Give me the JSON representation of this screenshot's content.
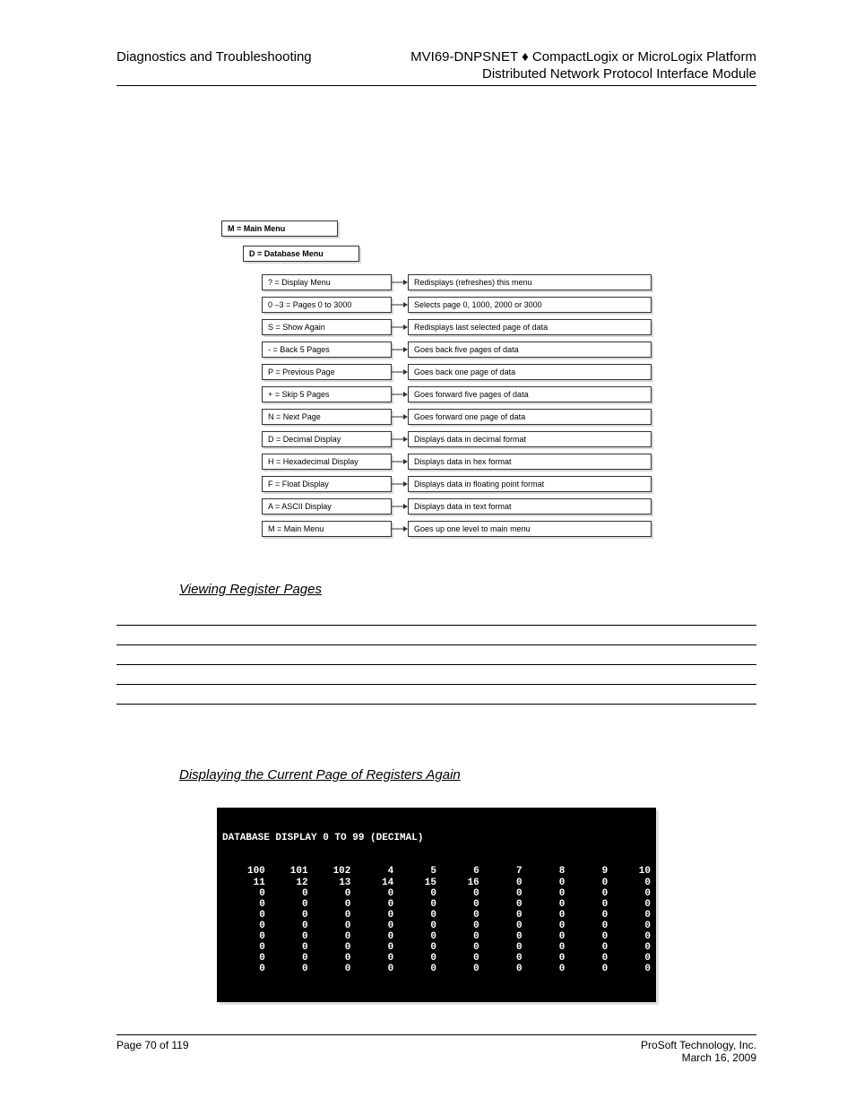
{
  "header": {
    "left": "Diagnostics and Troubleshooting",
    "right1": "MVI69-DNPSNET ♦ CompactLogix or MicroLogix Platform",
    "right2": "Distributed Network Protocol Interface Module"
  },
  "diagram": {
    "top1": "M = Main Menu",
    "top2": "D = Database Menu",
    "rows": [
      {
        "cmd": "? = Display Menu",
        "desc": "Redisplays (refreshes) this menu"
      },
      {
        "cmd": "0 –3 = Pages 0 to 3000",
        "desc": "Selects page 0, 1000, 2000 or 3000"
      },
      {
        "cmd": "S = Show Again",
        "desc": "Redisplays last selected page of data"
      },
      {
        "cmd": "- = Back 5 Pages",
        "desc": "Goes back five pages of data"
      },
      {
        "cmd": "P = Previous Page",
        "desc": "Goes back one page of data"
      },
      {
        "cmd": "+ = Skip 5 Pages",
        "desc": "Goes forward five pages of data"
      },
      {
        "cmd": "N = Next Page",
        "desc": "Goes forward one page of data"
      },
      {
        "cmd": "D = Decimal Display",
        "desc": "Displays data in decimal format"
      },
      {
        "cmd": "H = Hexadecimal Display",
        "desc": "Displays data in hex format"
      },
      {
        "cmd": "F = Float Display",
        "desc": "Displays data in floating point format"
      },
      {
        "cmd": "A = ASCII Display",
        "desc": "Displays data in text format"
      },
      {
        "cmd": "M = Main Menu",
        "desc": "Goes up one level to main menu"
      }
    ]
  },
  "section1": {
    "heading": "Viewing Register Pages"
  },
  "section2": {
    "heading": "Displaying the Current Page of Registers Again"
  },
  "terminal": {
    "title": "DATABASE DISPLAY 0 TO 99 (DECIMAL)",
    "rows": [
      [
        "100",
        "101",
        "102",
        "4",
        "5",
        "6",
        "7",
        "8",
        "9",
        "10"
      ],
      [
        "11",
        "12",
        "13",
        "14",
        "15",
        "16",
        "0",
        "0",
        "0",
        "0"
      ],
      [
        "0",
        "0",
        "0",
        "0",
        "0",
        "0",
        "0",
        "0",
        "0",
        "0"
      ],
      [
        "0",
        "0",
        "0",
        "0",
        "0",
        "0",
        "0",
        "0",
        "0",
        "0"
      ],
      [
        "0",
        "0",
        "0",
        "0",
        "0",
        "0",
        "0",
        "0",
        "0",
        "0"
      ],
      [
        "0",
        "0",
        "0",
        "0",
        "0",
        "0",
        "0",
        "0",
        "0",
        "0"
      ],
      [
        "0",
        "0",
        "0",
        "0",
        "0",
        "0",
        "0",
        "0",
        "0",
        "0"
      ],
      [
        "0",
        "0",
        "0",
        "0",
        "0",
        "0",
        "0",
        "0",
        "0",
        "0"
      ],
      [
        "0",
        "0",
        "0",
        "0",
        "0",
        "0",
        "0",
        "0",
        "0",
        "0"
      ],
      [
        "0",
        "0",
        "0",
        "0",
        "0",
        "0",
        "0",
        "0",
        "0",
        "0"
      ]
    ]
  },
  "footer": {
    "left1": "Page 70 of 119",
    "left2": "March 16, 2009",
    "right1": "ProSoft Technology, Inc."
  }
}
